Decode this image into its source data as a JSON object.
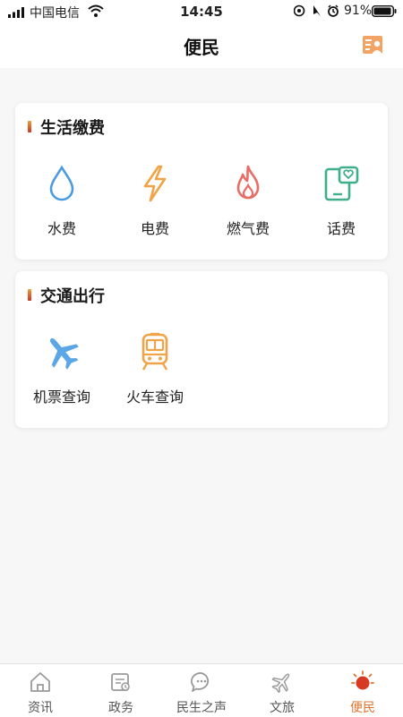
{
  "status_bar": {
    "carrier": "中国电信",
    "time": "14:45",
    "battery": "91%"
  },
  "header": {
    "title": "便民",
    "profile_icon": "contact-card-icon"
  },
  "colors": {
    "accent": "#e0742e",
    "water": "#4a9be0",
    "electric": "#f0a347",
    "gas": "#ea6c66",
    "phone": "#3fae8a"
  },
  "sections": [
    {
      "title": "生活缴费",
      "items": [
        {
          "label": "水费",
          "icon": "water-drop-icon"
        },
        {
          "label": "电费",
          "icon": "lightning-icon"
        },
        {
          "label": "燃气费",
          "icon": "flame-icon"
        },
        {
          "label": "话费",
          "icon": "phone-bill-icon"
        }
      ]
    },
    {
      "title": "交通出行",
      "items": [
        {
          "label": "机票查询",
          "icon": "airplane-icon"
        },
        {
          "label": "火车查询",
          "icon": "train-icon"
        }
      ]
    }
  ],
  "tabs": [
    {
      "label": "资讯",
      "icon": "home-icon",
      "active": false
    },
    {
      "label": "政务",
      "icon": "document-icon",
      "active": false
    },
    {
      "label": "民生之声",
      "icon": "chat-icon",
      "active": false
    },
    {
      "label": "文旅",
      "icon": "plane-tab-icon",
      "active": false
    },
    {
      "label": "便民",
      "icon": "sun-icon",
      "active": true
    }
  ]
}
